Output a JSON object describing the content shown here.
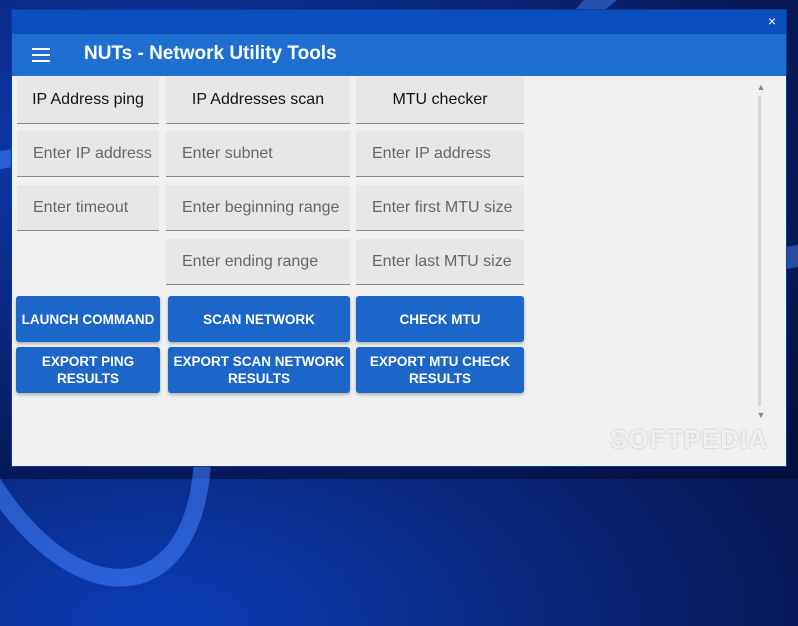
{
  "window": {
    "close_label": "×"
  },
  "header": {
    "title": "NUTs - Network Utility Tools"
  },
  "columns": [
    {
      "tab": "IP Address ping",
      "fields": [
        "Enter IP address",
        "Enter timeout"
      ],
      "buttons": [
        "LAUNCH COMMAND",
        "EXPORT PING RESULTS"
      ]
    },
    {
      "tab": "IP Addresses scan",
      "fields": [
        "Enter subnet",
        "Enter beginning range",
        "Enter ending range"
      ],
      "buttons": [
        "SCAN NETWORK",
        "EXPORT SCAN NETWORK RESULTS"
      ]
    },
    {
      "tab": "MTU checker",
      "fields": [
        "Enter IP address",
        "Enter first MTU size",
        "Enter last MTU size"
      ],
      "buttons": [
        "CHECK MTU",
        "EXPORT MTU CHECK RESULTS"
      ]
    }
  ],
  "scrollbar": {
    "up_icon": "▲",
    "down_icon": "▼"
  },
  "watermark": "SOFTPEDIA"
}
